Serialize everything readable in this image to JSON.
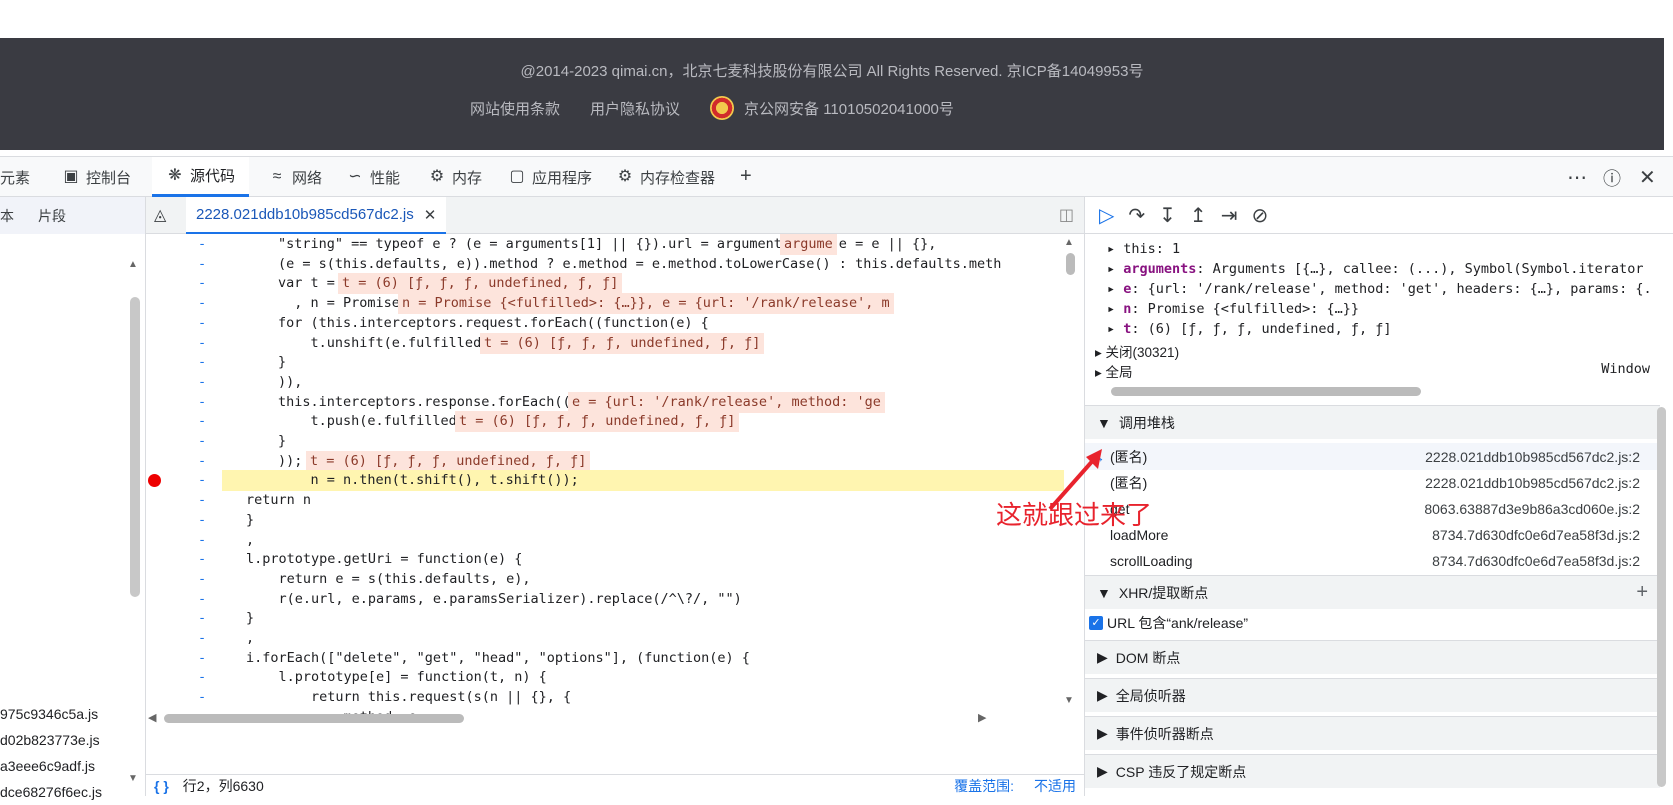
{
  "site_footer": {
    "copyright": "@2014-2023 qimai.cn，北京七麦科技股份有限公司 All Rights Reserved. 京ICP备14049953号",
    "links": [
      "网站使用条款",
      "用户隐私协议"
    ],
    "security_record": "京公网安备 11010502041000号"
  },
  "devtools": {
    "tabs": {
      "elements": "元素",
      "console": "控制台",
      "sources": "源代码",
      "network": "网络",
      "performance": "性能",
      "memory": "内存",
      "application": "应用程序",
      "memory_inspector": "内存检查器"
    },
    "left_panel": {
      "tabs": [
        "本",
        "片段"
      ],
      "files": [
        "975c9346c5a.js",
        "d02b823773e.js",
        "a3eee6c9adf.js",
        "dce68276f6ec.js"
      ]
    },
    "editor": {
      "file_tab": "2228.021ddb10b985cd567dc2.js",
      "status_position": "行2，列6630",
      "coverage_label": "覆盖范围:",
      "coverage_value": "不适用"
    },
    "scope": {
      "this": "this: 1",
      "arguments_key": "arguments",
      "arguments_val": ": Arguments [{…}, callee: (...), Symbol(Symbol.iterator",
      "e_key": "e",
      "e_val": ": {url: '/rank/release', method: 'get', headers: {…}, params: {.",
      "n_key": "n",
      "n_val": ": Promise {<fulfilled>: {…}}",
      "t_key": "t",
      "t_val": ": (6) [ƒ, ƒ, ƒ, undefined, ƒ, ƒ]",
      "closure": "关闭(30321)",
      "global": "全局",
      "global_val": "Window"
    },
    "call_stack": {
      "title": "调用堆栈",
      "frames": [
        {
          "name": "(匿名)",
          "loc": "2228.021ddb10b985cd567dc2.js:2"
        },
        {
          "name": "(匿名)",
          "loc": "2228.021ddb10b985cd567dc2.js:2"
        },
        {
          "name": "get",
          "loc": "8063.63887d3e9b86a3cd060e.js:2"
        },
        {
          "name": "loadMore",
          "loc": "8734.7d630dfc0e6d7ea58f3d.js:2"
        },
        {
          "name": "scrollLoading",
          "loc": "8734.7d630dfc0e6d7ea58f3d.js:2"
        }
      ]
    },
    "xhr": {
      "title": "XHR/提取断点",
      "item": "URL 包含“ank/release”"
    },
    "dom_breakpoints": "DOM 断点",
    "global_listeners": "全局侦听器",
    "event_listener_breakpoints": "事件侦听器断点",
    "csp": "CSP 违反了规定断点"
  },
  "annotation": "这就跟过来了",
  "code_lines": [
    {
      "g": "-",
      "html": "\"string\" == typeof e ? (e = arguments[1] || {}).url = arguments[0] : e = e || {},"
    },
    {
      "g": "-",
      "html": "(e = s(this.defaults, e)).method ? e.method = e.method.toLowerCase() : this.defaults.meth"
    },
    {
      "g": "-",
      "html": "var t = [o, void 0]"
    },
    {
      "g": "-",
      "html": "  , n = Promise.resolve(e);"
    },
    {
      "g": "-",
      "html": "for (this.interceptors.request.forEach((function(e) {"
    },
    {
      "g": "-",
      "html": "    t.unshift(e.fulfilled, e.rejected)"
    },
    {
      "g": "-",
      "html": "}"
    },
    {
      "g": "-",
      "html": ")),"
    },
    {
      "g": "-",
      "html": "this.interceptors.response.forEach((function(e) {"
    },
    {
      "g": "-",
      "html": "    t.push(e.fulfilled, e.rejected)"
    },
    {
      "g": "-",
      "html": "}"
    },
    {
      "g": "-",
      "html": ")); t.length; )"
    },
    {
      "g": "-",
      "html": "    n = n.then(t.shift(), t.shift());"
    },
    {
      "g": "-",
      "html": "return n"
    },
    {
      "g": "-",
      "html": "}"
    },
    {
      "g": "-",
      "html": ","
    },
    {
      "g": "-",
      "html": "l.prototype.getUri = function(e) {"
    },
    {
      "g": "-",
      "html": "    return e = s(this.defaults, e),"
    },
    {
      "g": "-",
      "html": "    r(e.url, e.params, e.paramsSerializer).replace(/^\\?/, \"\")"
    },
    {
      "g": "-",
      "html": "}"
    },
    {
      "g": "-",
      "html": ","
    },
    {
      "g": "-",
      "html": "i.forEach([\"delete\", \"get\", \"head\", \"options\"], (function(e) {"
    },
    {
      "g": "-",
      "html": "    l.prototype[e] = function(t, n) {"
    },
    {
      "g": "-",
      "html": "        return this.request(s(n || {}, {"
    },
    {
      "g": "-",
      "html": "            method: e,"
    }
  ],
  "inline_values": [
    "argume",
    "t = (6) [ƒ, ƒ, ƒ, undefined, ƒ, ƒ]",
    "n = Promise {<fulfilled>: {…}}, e = {url: '/rank/release', m",
    "t = (6) [ƒ, ƒ, ƒ, undefined, ƒ, ƒ]",
    "e = {url: '/rank/release', method: 'ge",
    "t = (6) [ƒ, ƒ, ƒ, undefined, ƒ, ƒ]",
    "t = (6) [ƒ, ƒ, ƒ, undefined, ƒ, ƒ]"
  ]
}
